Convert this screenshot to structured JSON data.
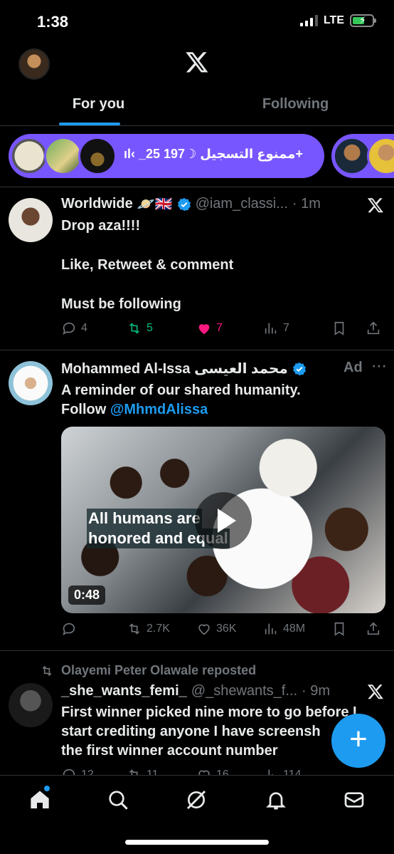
{
  "status_bar": {
    "time": "1:38",
    "network": "LTE"
  },
  "header": {
    "logo": "x-logo-icon"
  },
  "tabs": [
    {
      "label": "For you",
      "active": true
    },
    {
      "label": "Following",
      "active": false
    }
  ],
  "spaces": {
    "title": "ıl‹ _25 ممنوع التسجيل ☽197+"
  },
  "posts": [
    {
      "name": "Worldwide",
      "emoji": "🪐🇬🇧",
      "handle": "@iam_classi...",
      "time": "· 1m",
      "lines": [
        "Drop aza!!!!",
        "Like, Retweet & comment",
        "Must be following"
      ],
      "replies": "4",
      "reposts": "5",
      "likes": "7",
      "views": "7"
    },
    {
      "name": "Mohammed Al-Issa محمد العيسى",
      "ad_label": "Ad",
      "line1": "A reminder of our shared humanity.",
      "line2_prefix": "Follow ",
      "line2_link": "@MhmdAlissa",
      "media_caption": [
        "All humans are",
        "honored and equal"
      ],
      "duration": "0:48",
      "reposts": "2.7K",
      "likes": "36K",
      "views": "48M"
    },
    {
      "repost_by": "Olayemi Peter Olawale reposted",
      "name": "_she_wants_femi_",
      "handle": "@_shewants_f...",
      "time": "· 9m",
      "lines": [
        "First winner picked nine more to go before I",
        "start crediting anyone I have screensh",
        "the first winner account number"
      ],
      "replies": "12",
      "reposts": "11",
      "likes": "16",
      "views": "114"
    }
  ],
  "colors": {
    "accent": "#1d9bf0",
    "spaces": "#7856ff",
    "repost": "#00ba7c",
    "like": "#f91880"
  },
  "nav": [
    "home-icon",
    "search-icon",
    "grok-icon",
    "notifications-icon",
    "messages-icon"
  ]
}
